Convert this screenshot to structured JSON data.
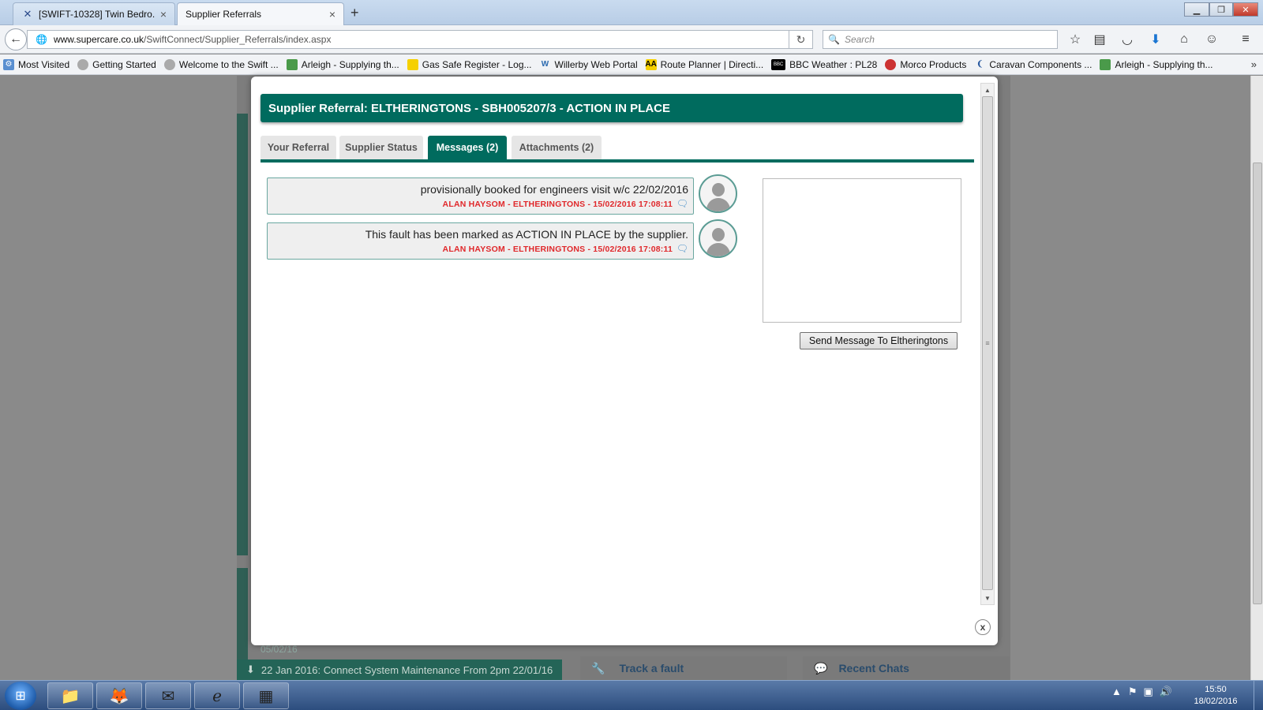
{
  "browser": {
    "tabs": [
      {
        "title": "[SWIFT-10328] Twin Bedro...",
        "icon": "jira-icon"
      },
      {
        "title": "Supplier Referrals",
        "icon": ""
      }
    ],
    "new_tab_label": "+",
    "url_domain": "www.supercare.co.uk",
    "url_path": "/SwiftConnect/Supplier_Referrals/index.aspx",
    "search_placeholder": "Search",
    "bookmarks": [
      {
        "label": "Most Visited",
        "icon": "gear-icon"
      },
      {
        "label": "Getting Started",
        "icon": "globe-icon"
      },
      {
        "label": "Welcome to the Swift ...",
        "icon": "globe-icon"
      },
      {
        "label": "Arleigh - Supplying th...",
        "icon": "arleigh-icon"
      },
      {
        "label": "Gas Safe Register - Log...",
        "icon": "gas-safe-icon"
      },
      {
        "label": "Willerby Web Portal",
        "icon": "willerby-icon"
      },
      {
        "label": "Route Planner | Directi...",
        "icon": "aa-icon"
      },
      {
        "label": "BBC Weather : PL28",
        "icon": "bbc-icon"
      },
      {
        "label": "Morco Products",
        "icon": "morco-icon"
      },
      {
        "label": "Caravan Components ...",
        "icon": "caravan-icon"
      },
      {
        "label": "Arleigh - Supplying th...",
        "icon": "arleigh-icon"
      }
    ]
  },
  "background": {
    "news_item": "22 Jan 2016: Connect System Maintenance From 2pm 22/01/16",
    "news_date": "05/02/16",
    "tile_track": "Track a fault",
    "tile_chats": "Recent Chats"
  },
  "modal": {
    "title": "Supplier Referral: ELTHERINGTONS - SBH005207/3 - ACTION IN PLACE",
    "tabs": [
      {
        "label": "Your Referral",
        "active": false
      },
      {
        "label": "Supplier Status",
        "active": false
      },
      {
        "label": "Messages (2)",
        "active": true
      },
      {
        "label": "Attachments (2)",
        "active": false
      }
    ],
    "messages": [
      {
        "text": "provisionally booked for engineers visit w/c 22/02/2016",
        "meta": "ALAN HAYSOM - ELTHERINGTONS - 15/02/2016 17:08:11"
      },
      {
        "text": "This fault has been marked as ACTION IN PLACE by the supplier.",
        "meta": "ALAN HAYSOM - ELTHERINGTONS - 15/02/2016 17:08:11"
      }
    ],
    "message_input_value": "",
    "send_button_label": "Send Message To Eltheringtons",
    "close_label": "x",
    "accent_color": "#006b5e",
    "meta_color": "#e0282b"
  },
  "taskbar": {
    "clock_time": "15:50",
    "clock_date": "18/02/2016"
  }
}
